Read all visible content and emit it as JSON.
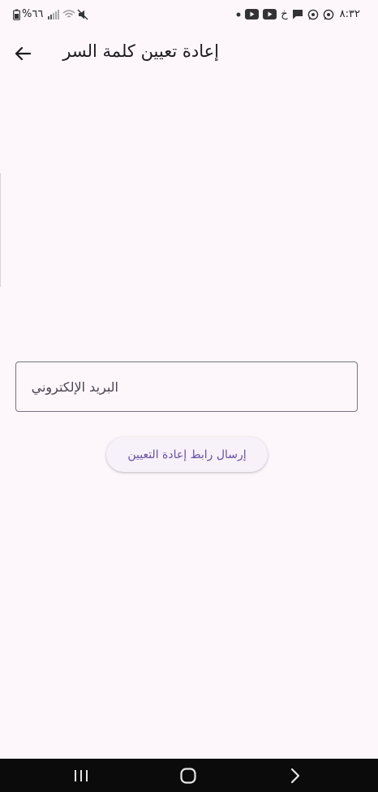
{
  "status_bar": {
    "time": "٨:٣٢",
    "carrier_letter": "خ",
    "battery": "%٦٦",
    "icons": [
      "whatsapp-icon",
      "whatsapp-icon",
      "message-icon",
      "youtube-icon",
      "youtube-icon",
      "dot-icon",
      "mute-icon",
      "wifi-icon",
      "signal-icon",
      "battery-icon"
    ]
  },
  "appbar": {
    "title": "إعادة تعيين كلمة السر",
    "back_icon": "arrow-back-icon"
  },
  "form": {
    "email_placeholder": "البريد الإلكتروني",
    "email_value": "",
    "send_button_label": "إرسال رابط إعادة التعيين"
  },
  "navigation_bar": {
    "icons": [
      "recents-icon",
      "home-icon",
      "back-icon"
    ]
  },
  "colors": {
    "background": "#fdf7fc",
    "primary": "#6750a4",
    "outline": "#79747e",
    "nav_bar": "#0b0b0c"
  }
}
